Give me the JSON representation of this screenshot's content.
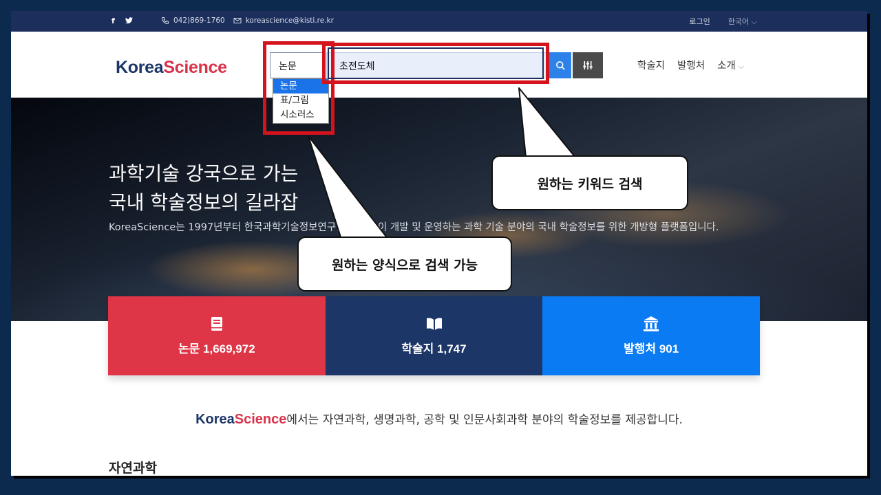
{
  "topbar": {
    "facebook": "f",
    "twitter": "🐦",
    "phone": "042)869-1760",
    "email": "koreascience@kisti.re.kr",
    "login": "로그인",
    "language": "한국어"
  },
  "logo": {
    "part1": "Korea",
    "part2": "Science"
  },
  "search": {
    "type_value": "논문",
    "query": "초전도체",
    "options": [
      "논문",
      "표/그림",
      "시소러스"
    ]
  },
  "nav": {
    "journals": "학술지",
    "publishers": "발행처",
    "about": "소개"
  },
  "hero": {
    "title_line1": "과학기술 강국으로 가는",
    "title_line2": "국내 학술정보의 길라잡",
    "desc": "KoreaScience는 1997년부터 한국과학기술정보연구원(KISTI)이 개발 및 운영하는 과학 기술 분야의 국내 학술정보를 위한 개방형 플랫폼입니다."
  },
  "stats": [
    {
      "label": "논문 1,669,972",
      "icon": "book-icon"
    },
    {
      "label": "학술지 1,747",
      "icon": "open-book-icon"
    },
    {
      "label": "발행처 901",
      "icon": "institution-icon"
    }
  ],
  "intro": {
    "brand1": "Korea",
    "brand2": "Science",
    "text": "에서는 자연과학, 생명과학, 공학 및 인문사회과학 분야의 학술정보를 제공합니다."
  },
  "section_title": "자연과학",
  "callouts": {
    "keyword": "원하는 키워드 검색",
    "format": "원하는 양식으로 검색 가능"
  },
  "colors": {
    "topbar": "#1c2e5c",
    "brand_navy": "#1c3668",
    "brand_red": "#d9334a",
    "card_red": "#de3547",
    "card_blue": "#0a7bf2",
    "annotation_red": "#d4131d"
  }
}
